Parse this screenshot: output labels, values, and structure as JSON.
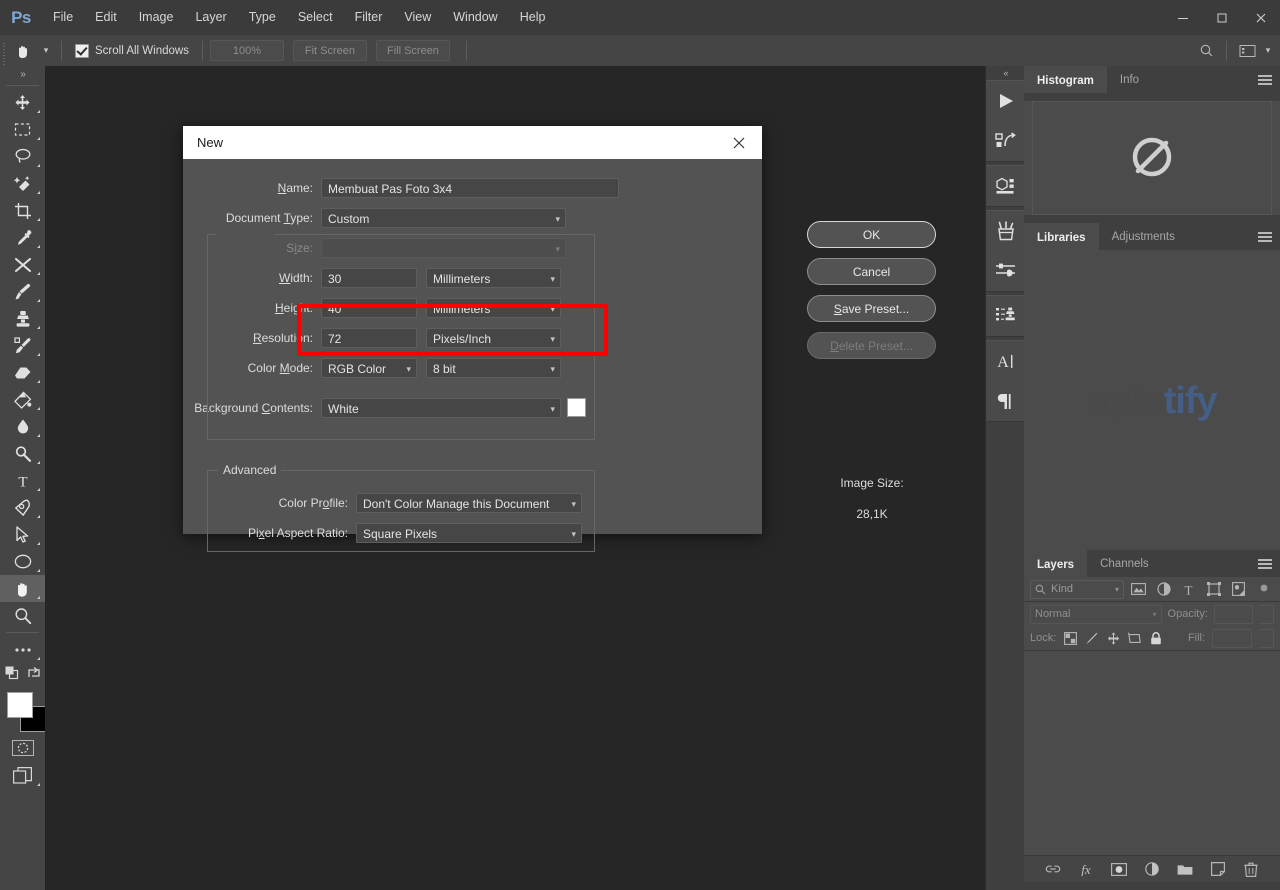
{
  "app": {
    "logo": "Ps",
    "menus": [
      "File",
      "Edit",
      "Image",
      "Layer",
      "Type",
      "Select",
      "Filter",
      "View",
      "Window",
      "Help"
    ],
    "window_controls": [
      "minimize",
      "maximize",
      "close"
    ]
  },
  "options_bar": {
    "tool_icon": "hand-tool-icon",
    "scroll_all_windows_label": "Scroll All Windows",
    "scroll_all_windows_checked": true,
    "buttons": [
      "100%",
      "Fit Screen",
      "Fill Screen"
    ],
    "right_icons": [
      "search-icon",
      "workspace-icon"
    ]
  },
  "toolbar": {
    "expand_glyph": "»",
    "tools": [
      {
        "name": "move-tool",
        "active": false
      },
      {
        "name": "rectangular-marquee-tool",
        "active": false
      },
      {
        "name": "lasso-tool",
        "active": false
      },
      {
        "name": "quick-selection-tool",
        "active": false
      },
      {
        "name": "crop-tool",
        "active": false
      },
      {
        "name": "eyedropper-tool",
        "active": false
      },
      {
        "name": "healing-brush-tool",
        "active": false
      },
      {
        "name": "brush-tool",
        "active": false
      },
      {
        "name": "clone-stamp-tool",
        "active": false
      },
      {
        "name": "history-brush-tool",
        "active": false
      },
      {
        "name": "eraser-tool",
        "active": false
      },
      {
        "name": "gradient-tool",
        "active": false
      },
      {
        "name": "blur-tool",
        "active": false
      },
      {
        "name": "dodge-tool",
        "active": false
      },
      {
        "name": "type-tool",
        "active": false
      },
      {
        "name": "pen-tool",
        "active": false
      },
      {
        "name": "path-selection-tool",
        "active": false
      },
      {
        "name": "ellipse-tool",
        "active": false
      },
      {
        "name": "hand-tool",
        "active": true
      },
      {
        "name": "zoom-tool",
        "active": false
      },
      {
        "name": "edit-toolbar-tool",
        "active": false
      }
    ],
    "foreground_color": "#ffffff",
    "background_color": "#000000",
    "quick_mask_icon": "quick-mask-icon",
    "screen_mode_icon": "screen-mode-icon"
  },
  "rail": {
    "collapse_glyph": "«",
    "groups": [
      [
        "play-icon",
        "step-action-icon"
      ],
      [
        "3d-panel-icon"
      ],
      [
        "brush-presets-icon",
        "brush-settings-icon"
      ],
      [
        "clone-source-icon"
      ],
      [
        "character-panel-icon",
        "paragraph-panel-icon"
      ]
    ]
  },
  "panels": {
    "histogram": {
      "tabs": [
        {
          "label": "Histogram",
          "active": true
        },
        {
          "label": "Info",
          "active": false
        }
      ],
      "empty_icon": "empty-slash-circle-icon"
    },
    "libraries": {
      "tabs": [
        {
          "label": "Libraries",
          "active": true
        },
        {
          "label": "Adjustments",
          "active": false
        }
      ],
      "watermark_part1": "uplo",
      "watermark_part2": "tify",
      "watermark_color1": "#4a4a4a",
      "watermark_color2": "#3f6fb5"
    },
    "layers": {
      "tabs": [
        {
          "label": "Layers",
          "active": true
        },
        {
          "label": "Channels",
          "active": false
        }
      ],
      "filter_kind_label": "Kind",
      "filter_icons": [
        "pixel-layer-filter-icon",
        "adjustment-layer-filter-icon",
        "type-layer-filter-icon",
        "shape-layer-filter-icon",
        "smart-object-filter-icon",
        "filter-toggle-icon"
      ],
      "blend_mode": "Normal",
      "opacity_label": "Opacity:",
      "opacity_value": "",
      "lock_label": "Lock:",
      "lock_icons": [
        "lock-transparent-pixels-icon",
        "lock-image-pixels-icon",
        "lock-position-icon",
        "lock-artboard-icon",
        "lock-all-icon"
      ],
      "fill_label": "Fill:",
      "fill_value": "",
      "footer_icons": [
        "link-layers-icon",
        "layer-style-fx-icon",
        "layer-mask-icon",
        "new-adjustment-layer-icon",
        "new-group-icon",
        "new-layer-icon",
        "delete-layer-icon"
      ]
    }
  },
  "dialog": {
    "title": "New",
    "close_icon": "close-icon",
    "fields": {
      "name": {
        "label_pre": "N",
        "label_post": "ame:",
        "value": "Membuat Pas Foto 3x4"
      },
      "document_type": {
        "label_pre": "Document ",
        "label_mid": "T",
        "label_post": "ype:",
        "value": "Custom"
      },
      "size": {
        "label_pre": "S",
        "label_mid": "i",
        "label_post": "ze:",
        "value": "",
        "disabled": true
      },
      "width": {
        "label_pre": "W",
        "label_mid": "i",
        "label_post": "dth:",
        "value": "30",
        "unit": "Millimeters"
      },
      "height": {
        "label_pre": "H",
        "label_mid": "e",
        "label_post": "ight:",
        "value": "40",
        "unit": "Millimeters"
      },
      "resolution": {
        "label_pre": "R",
        "label_mid": "e",
        "label_post": "solution:",
        "value": "72",
        "unit": "Pixels/Inch"
      },
      "color_mode": {
        "label_pre": "Color ",
        "label_mid": "M",
        "label_post": "ode:",
        "value": "RGB Color",
        "depth": "8 bit"
      },
      "background_contents": {
        "label_pre": "Background ",
        "label_mid": "C",
        "label_post": "ontents:",
        "value": "White",
        "swatch_color": "#ffffff"
      },
      "color_profile": {
        "label_pre": "Color Pr",
        "label_mid": "o",
        "label_post": "file:",
        "value": "Don't Color Manage this Document"
      },
      "pixel_aspect_ratio": {
        "label_pre": "Pi",
        "label_mid": "x",
        "label_post": "el Aspect Ratio:",
        "value": "Square Pixels"
      }
    },
    "advanced_legend": "Advanced",
    "buttons": [
      {
        "label": "OK",
        "pre": "",
        "mnemonic": "",
        "post": "OK",
        "state": "primary"
      },
      {
        "label": "Cancel",
        "pre": "",
        "mnemonic": "",
        "post": "Cancel",
        "state": "normal"
      },
      {
        "label": "Save Preset...",
        "pre": "",
        "mnemonic": "S",
        "post": "ave Preset...",
        "state": "normal"
      },
      {
        "label": "Delete Preset...",
        "pre": "",
        "mnemonic": "D",
        "post": "elete Preset...",
        "state": "disabled"
      }
    ],
    "image_size_label": "Image Size:",
    "image_size_value": "28,1K",
    "highlight_color": "#fb0000"
  }
}
